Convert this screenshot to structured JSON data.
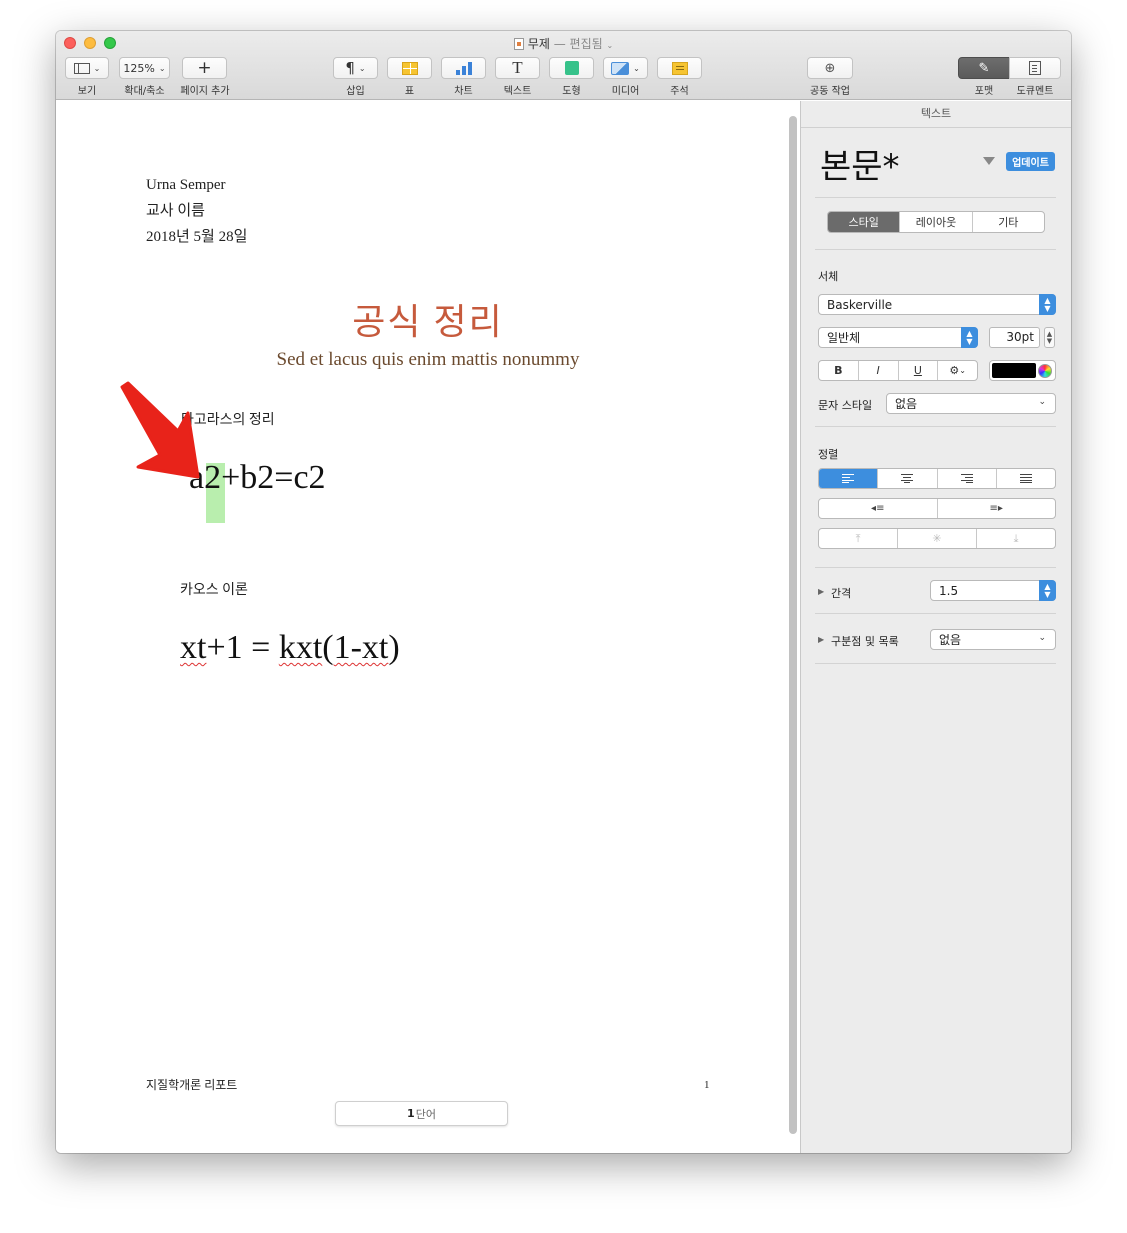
{
  "window": {
    "title": "무제",
    "title_status": "— 편집됨",
    "colors": {
      "close": "#fc605c",
      "minimize": "#fdbc40",
      "zoom": "#34c84a"
    }
  },
  "toolbar": {
    "view_label": "보기",
    "zoom_value": "125%",
    "zoom_label": "확대/축소",
    "add_page_symbol": "+",
    "add_page_label": "페이지 추가",
    "insert_symbol": "¶",
    "insert_label": "삽입",
    "table_label": "표",
    "chart_label": "차트",
    "text_symbol": "T",
    "text_label": "텍스트",
    "shape_label": "도형",
    "media_label": "미디어",
    "comment_label": "주석",
    "collab_label": "공동 작업",
    "format_label": "포맷",
    "document_label": "도큐멘트"
  },
  "document": {
    "author": "Urna Semper",
    "teacher": "교사 이름",
    "date": "2018년 5월 28일",
    "title": "공식 정리",
    "subtitle": "Sed et lacus quis enim mattis nonummy",
    "heading1": "타고라스의 정리",
    "formula1_a": "a",
    "formula1_sel": "2",
    "formula1_rest": "+b2=c2",
    "heading2": "카오스 이론",
    "formula2_xt": "xt",
    "formula2_mid": "+1 = ",
    "formula2_kxt": "kxt",
    "formula2_paren_open": "(",
    "formula2_inner": "1-xt",
    "formula2_paren_close": ")",
    "footer_left": "지질학개론 리포트",
    "page_number": "1",
    "word_count_num": "1",
    "word_count_unit": "단어",
    "highlight_color": "#b9eeae",
    "title_color": "#c65a3c",
    "annotation_arrow_color": "#e8231a"
  },
  "panel": {
    "tab_label": "텍스트",
    "style_name": "본문*",
    "update_label": "업데이트",
    "tabs": [
      "스타일",
      "레이아웃",
      "기타"
    ],
    "font_section": "서체",
    "font_family": "Baskerville",
    "font_weight": "일반체",
    "font_size": "30pt",
    "bold": "B",
    "italic": "I",
    "underline": "U",
    "more_symbol": "⚙",
    "char_style_label": "문자 스타일",
    "char_style_value": "없음",
    "align_section": "정렬",
    "spacing_label": "간격",
    "spacing_value": "1.5",
    "bullets_label": "구분점 및 목록",
    "bullets_value": "없음",
    "accent": "#3d8ede"
  }
}
